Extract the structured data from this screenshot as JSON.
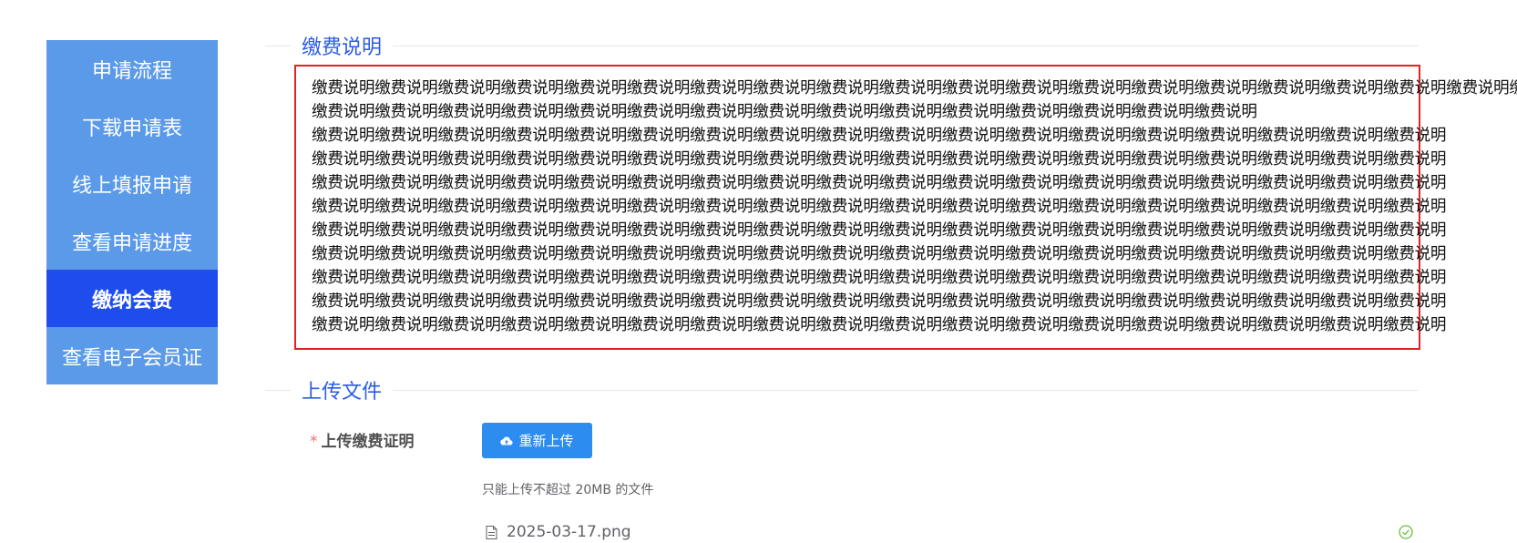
{
  "sidebar": {
    "items": [
      {
        "label": "申请流程",
        "active": false
      },
      {
        "label": "下载申请表",
        "active": false
      },
      {
        "label": "线上填报申请",
        "active": false
      },
      {
        "label": "查看申请进度",
        "active": false
      },
      {
        "label": "缴纳会费",
        "active": true
      },
      {
        "label": "查看电子会员证",
        "active": false
      }
    ]
  },
  "fee_section": {
    "title": "缴费说明",
    "lines": [
      "缴费说明缴费说明缴费说明缴费说明缴费说明缴费说明缴费说明缴费说明缴费说明缴费说明缴费说明缴费说明缴费说明缴费说明缴费说明缴费说明缴费说明缴费说明缴费说明缴费说明",
      "缴费说明缴费说明缴费说明缴费说明缴费说明缴费说明缴费说明缴费说明缴费说明缴费说明缴费说明缴费说明缴费说明缴费说明缴费说明",
      "缴费说明缴费说明缴费说明缴费说明缴费说明缴费说明缴费说明缴费说明缴费说明缴费说明缴费说明缴费说明缴费说明缴费说明缴费说明缴费说明缴费说明缴费说明",
      "缴费说明缴费说明缴费说明缴费说明缴费说明缴费说明缴费说明缴费说明缴费说明缴费说明缴费说明缴费说明缴费说明缴费说明缴费说明缴费说明缴费说明缴费说明",
      "缴费说明缴费说明缴费说明缴费说明缴费说明缴费说明缴费说明缴费说明缴费说明缴费说明缴费说明缴费说明缴费说明缴费说明缴费说明缴费说明缴费说明缴费说明",
      "缴费说明缴费说明缴费说明缴费说明缴费说明缴费说明缴费说明缴费说明缴费说明缴费说明缴费说明缴费说明缴费说明缴费说明缴费说明缴费说明缴费说明缴费说明",
      "缴费说明缴费说明缴费说明缴费说明缴费说明缴费说明缴费说明缴费说明缴费说明缴费说明缴费说明缴费说明缴费说明缴费说明缴费说明缴费说明缴费说明缴费说明",
      "缴费说明缴费说明缴费说明缴费说明缴费说明缴费说明缴费说明缴费说明缴费说明缴费说明缴费说明缴费说明缴费说明缴费说明缴费说明缴费说明缴费说明缴费说明",
      "缴费说明缴费说明缴费说明缴费说明缴费说明缴费说明缴费说明缴费说明缴费说明缴费说明缴费说明缴费说明缴费说明缴费说明缴费说明缴费说明缴费说明缴费说明",
      "缴费说明缴费说明缴费说明缴费说明缴费说明缴费说明缴费说明缴费说明缴费说明缴费说明缴费说明缴费说明缴费说明缴费说明缴费说明缴费说明缴费说明缴费说明",
      "缴费说明缴费说明缴费说明缴费说明缴费说明缴费说明缴费说明缴费说明缴费说明缴费说明缴费说明缴费说明缴费说明缴费说明缴费说明缴费说明缴费说明缴费说明"
    ]
  },
  "upload_section": {
    "title": "上传文件",
    "required_mark": "*",
    "field_label": "上传缴费证明",
    "button_label": "重新上传",
    "button_icon": "cloud-upload-icon",
    "tip": "只能上传不超过 20MB 的文件",
    "file": {
      "name": "2025-03-17.png",
      "file_icon": "document-icon",
      "status_icon": "success-check-icon"
    }
  },
  "colors": {
    "sidebar_bg": "#5b9ae8",
    "sidebar_active_bg": "#1f4ded",
    "section_title": "#2a5ce6",
    "highlight_border": "#e02424",
    "primary_button": "#2d8cf0",
    "success": "#67c23a"
  }
}
